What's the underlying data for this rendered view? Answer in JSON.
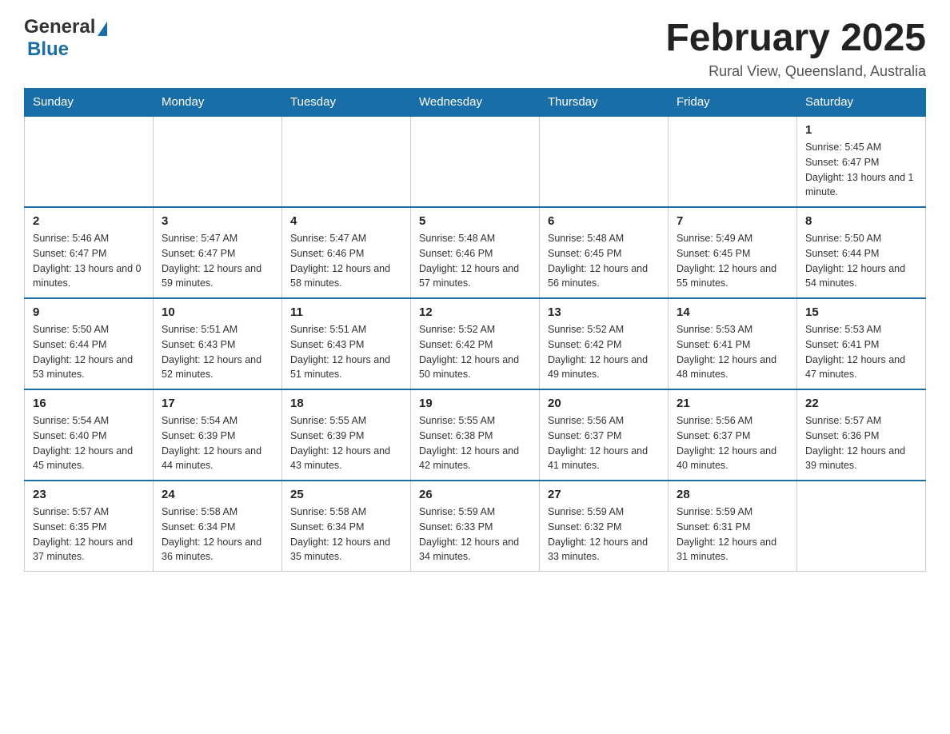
{
  "header": {
    "logo": {
      "general": "General",
      "blue": "Blue"
    },
    "title": "February 2025",
    "location": "Rural View, Queensland, Australia"
  },
  "calendar": {
    "days_of_week": [
      "Sunday",
      "Monday",
      "Tuesday",
      "Wednesday",
      "Thursday",
      "Friday",
      "Saturday"
    ],
    "weeks": [
      [
        {
          "day": "",
          "info": ""
        },
        {
          "day": "",
          "info": ""
        },
        {
          "day": "",
          "info": ""
        },
        {
          "day": "",
          "info": ""
        },
        {
          "day": "",
          "info": ""
        },
        {
          "day": "",
          "info": ""
        },
        {
          "day": "1",
          "info": "Sunrise: 5:45 AM\nSunset: 6:47 PM\nDaylight: 13 hours and 1 minute."
        }
      ],
      [
        {
          "day": "2",
          "info": "Sunrise: 5:46 AM\nSunset: 6:47 PM\nDaylight: 13 hours and 0 minutes."
        },
        {
          "day": "3",
          "info": "Sunrise: 5:47 AM\nSunset: 6:47 PM\nDaylight: 12 hours and 59 minutes."
        },
        {
          "day": "4",
          "info": "Sunrise: 5:47 AM\nSunset: 6:46 PM\nDaylight: 12 hours and 58 minutes."
        },
        {
          "day": "5",
          "info": "Sunrise: 5:48 AM\nSunset: 6:46 PM\nDaylight: 12 hours and 57 minutes."
        },
        {
          "day": "6",
          "info": "Sunrise: 5:48 AM\nSunset: 6:45 PM\nDaylight: 12 hours and 56 minutes."
        },
        {
          "day": "7",
          "info": "Sunrise: 5:49 AM\nSunset: 6:45 PM\nDaylight: 12 hours and 55 minutes."
        },
        {
          "day": "8",
          "info": "Sunrise: 5:50 AM\nSunset: 6:44 PM\nDaylight: 12 hours and 54 minutes."
        }
      ],
      [
        {
          "day": "9",
          "info": "Sunrise: 5:50 AM\nSunset: 6:44 PM\nDaylight: 12 hours and 53 minutes."
        },
        {
          "day": "10",
          "info": "Sunrise: 5:51 AM\nSunset: 6:43 PM\nDaylight: 12 hours and 52 minutes."
        },
        {
          "day": "11",
          "info": "Sunrise: 5:51 AM\nSunset: 6:43 PM\nDaylight: 12 hours and 51 minutes."
        },
        {
          "day": "12",
          "info": "Sunrise: 5:52 AM\nSunset: 6:42 PM\nDaylight: 12 hours and 50 minutes."
        },
        {
          "day": "13",
          "info": "Sunrise: 5:52 AM\nSunset: 6:42 PM\nDaylight: 12 hours and 49 minutes."
        },
        {
          "day": "14",
          "info": "Sunrise: 5:53 AM\nSunset: 6:41 PM\nDaylight: 12 hours and 48 minutes."
        },
        {
          "day": "15",
          "info": "Sunrise: 5:53 AM\nSunset: 6:41 PM\nDaylight: 12 hours and 47 minutes."
        }
      ],
      [
        {
          "day": "16",
          "info": "Sunrise: 5:54 AM\nSunset: 6:40 PM\nDaylight: 12 hours and 45 minutes."
        },
        {
          "day": "17",
          "info": "Sunrise: 5:54 AM\nSunset: 6:39 PM\nDaylight: 12 hours and 44 minutes."
        },
        {
          "day": "18",
          "info": "Sunrise: 5:55 AM\nSunset: 6:39 PM\nDaylight: 12 hours and 43 minutes."
        },
        {
          "day": "19",
          "info": "Sunrise: 5:55 AM\nSunset: 6:38 PM\nDaylight: 12 hours and 42 minutes."
        },
        {
          "day": "20",
          "info": "Sunrise: 5:56 AM\nSunset: 6:37 PM\nDaylight: 12 hours and 41 minutes."
        },
        {
          "day": "21",
          "info": "Sunrise: 5:56 AM\nSunset: 6:37 PM\nDaylight: 12 hours and 40 minutes."
        },
        {
          "day": "22",
          "info": "Sunrise: 5:57 AM\nSunset: 6:36 PM\nDaylight: 12 hours and 39 minutes."
        }
      ],
      [
        {
          "day": "23",
          "info": "Sunrise: 5:57 AM\nSunset: 6:35 PM\nDaylight: 12 hours and 37 minutes."
        },
        {
          "day": "24",
          "info": "Sunrise: 5:58 AM\nSunset: 6:34 PM\nDaylight: 12 hours and 36 minutes."
        },
        {
          "day": "25",
          "info": "Sunrise: 5:58 AM\nSunset: 6:34 PM\nDaylight: 12 hours and 35 minutes."
        },
        {
          "day": "26",
          "info": "Sunrise: 5:59 AM\nSunset: 6:33 PM\nDaylight: 12 hours and 34 minutes."
        },
        {
          "day": "27",
          "info": "Sunrise: 5:59 AM\nSunset: 6:32 PM\nDaylight: 12 hours and 33 minutes."
        },
        {
          "day": "28",
          "info": "Sunrise: 5:59 AM\nSunset: 6:31 PM\nDaylight: 12 hours and 31 minutes."
        },
        {
          "day": "",
          "info": ""
        }
      ]
    ]
  }
}
